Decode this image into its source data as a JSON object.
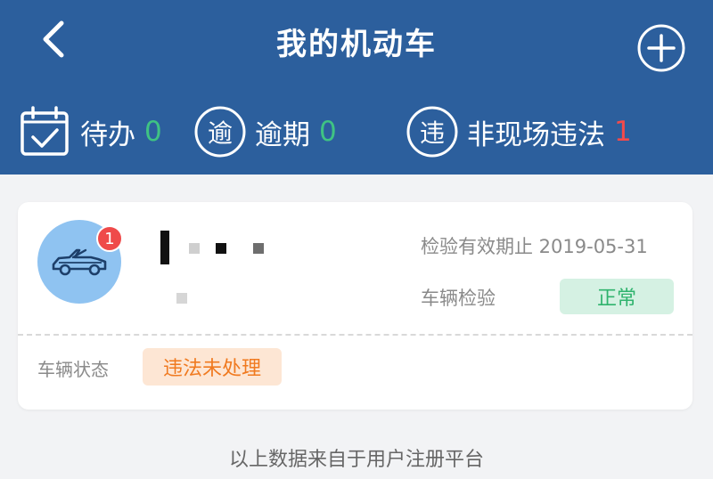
{
  "header": {
    "title": "我的机动车",
    "back_icon": "chevron-left-icon",
    "add_icon": "plus-circle-icon"
  },
  "stats": {
    "todo": {
      "label": "待办",
      "count": "0",
      "icon": "calendar-check-icon"
    },
    "overdue": {
      "label": "逾期",
      "count": "0",
      "icon_char": "逾",
      "icon": "overdue-icon"
    },
    "violation": {
      "label": "非现场违法",
      "count": "1",
      "icon_char": "违",
      "icon": "violation-icon"
    }
  },
  "vehicle": {
    "badge_count": "1",
    "avatar_icon": "car-icon",
    "inspection_expiry": "检验有效期止 2019-05-31",
    "inspection_label": "车辆检验",
    "inspection_status": "正常",
    "status_label": "车辆状态",
    "status_value": "违法未处理"
  },
  "footer": {
    "note": "以上数据来自于用户注册平台"
  },
  "colors": {
    "header_bg": "#2c5f9d",
    "zero_count": "#3fc383",
    "alert_count": "#f44a4a",
    "ok_badge_bg": "#d5f1e3",
    "ok_badge_text": "#2fb36d",
    "warn_badge_bg": "#fde6d4",
    "warn_badge_text": "#f07a20"
  }
}
